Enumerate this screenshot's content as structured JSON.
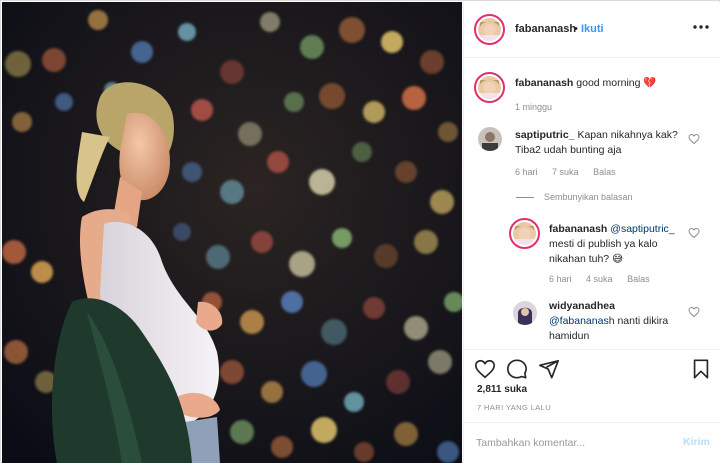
{
  "post": {
    "author": "fabananash",
    "dot": "•",
    "follow_label": "Ikuti",
    "more_icon": "more-horizontal-icon"
  },
  "caption": {
    "author": "fabananash",
    "text": "good morning",
    "emoji": "💔",
    "time": "1 minggu"
  },
  "comments": [
    {
      "author": "saptiputric_",
      "text_line1": "Kapan nikahnya kak?",
      "text_line2": "Tiba2 udah bunting aja",
      "time": "6 hari",
      "likes": "7 suka",
      "reply": "Balas"
    }
  ],
  "hide_replies": "Sembunyikan balasan",
  "replies": [
    {
      "author": "fabananash",
      "mention": "@saptiputric_",
      "text_line2": "mesti di publish ya kalo",
      "text_line3": "nikahan tuh?",
      "emoji": "😅",
      "time": "6 hari",
      "likes": "4 suka",
      "reply": "Balas"
    }
  ],
  "comment2": {
    "author": "widyanadhea",
    "mention": "@fabananash",
    "text": "nanti dikira",
    "text_line2": "hamidun"
  },
  "actions": {
    "like_icon": "heart-icon",
    "comment_icon": "comment-icon",
    "share_icon": "share-icon",
    "save_icon": "bookmark-icon"
  },
  "likes_label": "2,811 suka",
  "date": "7 HARI YANG LALU",
  "compose": {
    "placeholder": "Tambahkan komentar...",
    "post_label": "Kirim"
  },
  "colors": {
    "accent": "#3897f0",
    "story_ring": "#e1306c",
    "post_disabled": "#b2dffc"
  }
}
